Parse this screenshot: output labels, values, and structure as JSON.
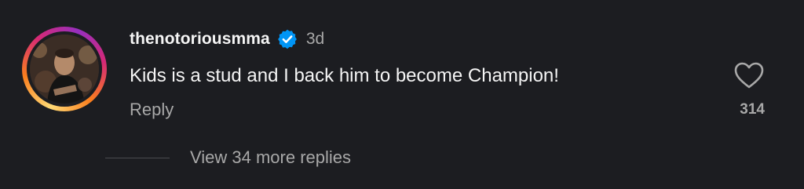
{
  "comment": {
    "username": "thenotoriousmma",
    "verified": true,
    "time": "3d",
    "text": "Kids is a stud and I back him to become Champion!",
    "reply_label": "Reply",
    "like_count": "314",
    "view_replies_label": "View 34 more replies"
  },
  "icons": {
    "verified": "verified-badge-icon",
    "like": "heart-icon"
  },
  "colors": {
    "background": "#1c1d21",
    "primary_text": "#f5f5f5",
    "secondary_text": "#a8a8a8",
    "verified_blue": "#0095f6"
  }
}
